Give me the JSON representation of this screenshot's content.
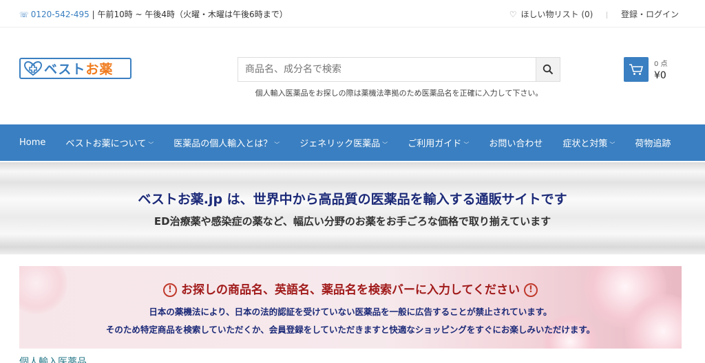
{
  "topbar": {
    "phone": "0120-542-495",
    "hours": "| 午前10時 ~ 午後4時（火曜・木曜は午後6時まで）",
    "wishlist": "ほしい物リスト (0)",
    "login": "登録・ログイン"
  },
  "logo": {
    "part1": "ベスト",
    "part2": "お薬"
  },
  "search": {
    "placeholder": "商品名、成分名で検索",
    "notice": "個人輸入医薬品をお探しの際は薬機法準拠のため医薬品名を正確に入力して下さい。"
  },
  "cart": {
    "count": "0 点",
    "price": "¥0"
  },
  "nav": {
    "items": [
      {
        "label": "Home"
      },
      {
        "label": "ベストお薬について"
      },
      {
        "label": "医薬品の個人輸入とは？"
      },
      {
        "label": "ジェネリック医薬品"
      },
      {
        "label": "ご利用ガイド"
      },
      {
        "label": "お問い合わせ"
      },
      {
        "label": "症状と対策"
      },
      {
        "label": "荷物追跡"
      }
    ]
  },
  "banner": {
    "headline": "ベストお薬.jp は、世界中から高品質の医薬品を輸入する通販サイトです",
    "subline": "ED治療薬や感染症の薬など、幅広い分野のお薬をお手ごろな価格で取り揃えています"
  },
  "search_banner": {
    "title": "お探しの商品名、英語名、薬品名を検索バーに入力してください",
    "line1": "日本の薬機法により、日本の法的認証を受けていない医薬品を一般に広告することが禁止されています。",
    "line2": "そのため特定商品を検索していただくか、会員登録をしていただきますと快適なショッピングをすぐにお楽しみいただけます。"
  },
  "section_heading": "個人輸入医薬品"
}
